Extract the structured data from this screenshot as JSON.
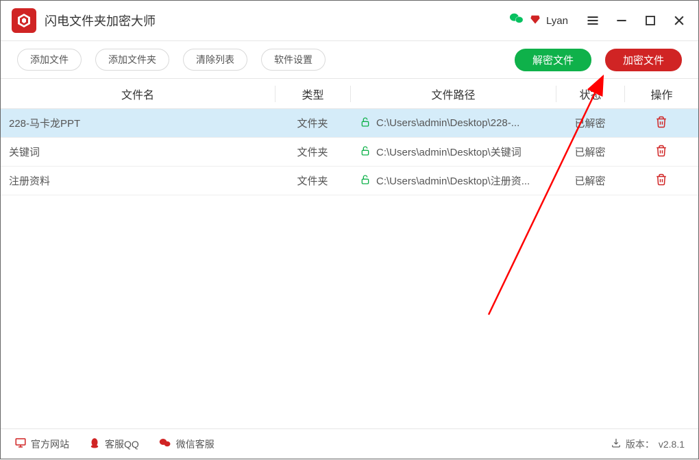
{
  "app": {
    "title": "闪电文件夹加密大师"
  },
  "user": {
    "name": "Lyan"
  },
  "toolbar": {
    "add_file": "添加文件",
    "add_folder": "添加文件夹",
    "clear_list": "清除列表",
    "settings": "软件设置",
    "decrypt": "解密文件",
    "encrypt": "加密文件"
  },
  "table": {
    "headers": {
      "name": "文件名",
      "type": "类型",
      "path": "文件路径",
      "status": "状态",
      "action": "操作"
    },
    "rows": [
      {
        "name": "228-马卡龙PPT",
        "type": "文件夹",
        "path": "C:\\Users\\admin\\Desktop\\228-...",
        "status": "已解密",
        "selected": true
      },
      {
        "name": "关键词",
        "type": "文件夹",
        "path": "C:\\Users\\admin\\Desktop\\关键词",
        "status": "已解密",
        "selected": false
      },
      {
        "name": "注册资料",
        "type": "文件夹",
        "path": "C:\\Users\\admin\\Desktop\\注册资...",
        "status": "已解密",
        "selected": false
      }
    ]
  },
  "footer": {
    "website": "官方网站",
    "qq": "客服QQ",
    "wechat": "微信客服",
    "version_label": "版本：",
    "version": "v2.8.1"
  }
}
